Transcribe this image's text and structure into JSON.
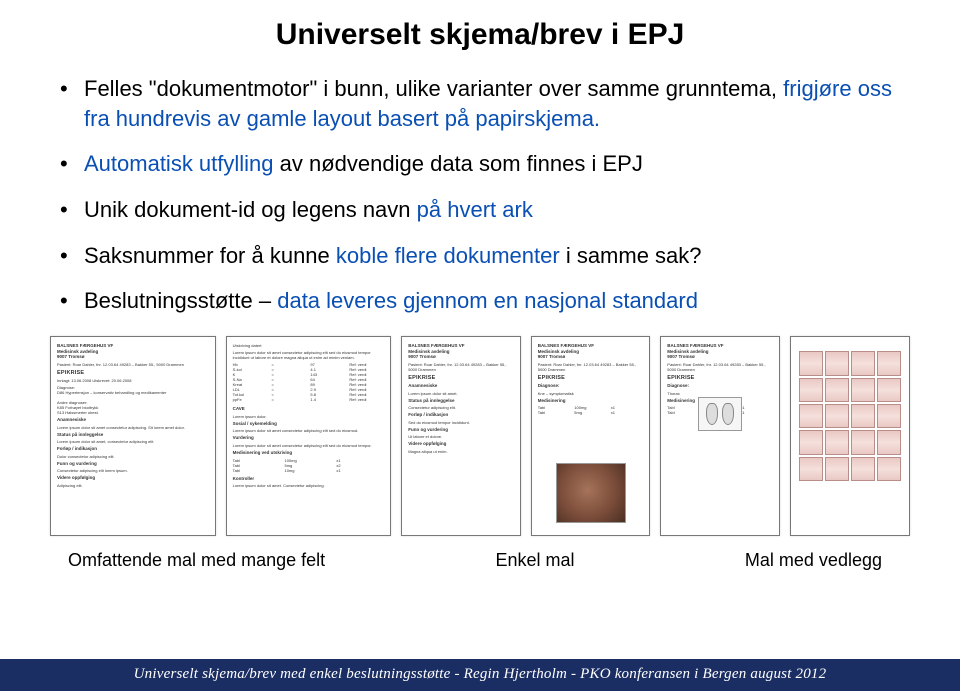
{
  "title": "Universelt skjema/brev i EPJ",
  "bullets": [
    {
      "pre": "Felles \"dokumentmotor\" i bunn, ulike varianter over samme grunntema, ",
      "blue": "frigjøre oss fra hundrevis av gamle layout basert på papirskjema.",
      "post": ""
    },
    {
      "pre": "",
      "blue": "Automatisk utfylling",
      "post": " av nødvendige data som finnes i EPJ"
    },
    {
      "pre": "Unik dokument-id og legens navn ",
      "blue": "på hvert ark",
      "post": ""
    },
    {
      "pre": "Saksnummer for å kunne ",
      "blue": "koble flere dokumenter",
      "post": " i samme sak?"
    },
    {
      "pre": "Beslutningsstøtte – ",
      "blue": "data leveres gjennom en nasjonal standard",
      "post": ""
    }
  ],
  "thumbs": {
    "t1": {
      "hdr": "BALSNES FÆRGEHUS VF\nMedisinsk avdeling\n9007 Tromsø",
      "pt": "Pasient: Roar Dahler, fnr. 12.03.64 49283 – Bakker 55., 5000 Drammen",
      "sec": "EPIKRISE",
      "p1": "Innlagt: 13.06.2008 Utskrevet: 20.06.2008",
      "p2": "Diagnose:\nD86 Hypertensjon – konservativ behandling og medikamenter\n\nAndre diagnoser:\nK85 Forhøyet blodtrykk\nS13 Halssmerter ubest.",
      "b1": "Anamnesiske",
      "b2": "Status på innleggelse",
      "b3": "Forløp / indikasjon",
      "b4": "Funn og vurdering",
      "b5": "Videre oppfølging"
    },
    "t2": {
      "top": "Utskriving datert",
      "rows": "Hb\nS-kol\nK\nS-Na\nKreat\nLDL\nTot.kol\nppFe",
      "b1": "CAVE",
      "b2": "Sosial / sykemelding",
      "b3": "Vurdering",
      "b4": "Medisinering ved utskriving",
      "b5": "Kontroller"
    },
    "t3": {
      "hdr": "BALSNES FÆRGEHUS VF\nMedisinsk avdeling\n9007 Tromsø",
      "pt": "Pasient: Roar Dahler, fnr. 12.03.64 49283 – Bakker 55., 5000 Drammen",
      "sec": "EPIKRISE",
      "b1": "Anamnesiske",
      "b2": "Status på innleggelse",
      "b3": "Forløp / indikasjon",
      "b4": "Funn og vurdering",
      "b5": "Videre oppfølging"
    },
    "t4_sec": "EPIKRISE",
    "t4_b": "Medisinering",
    "t5_sec": "EPIKRISE",
    "t5_b": "Medisinering",
    "t6_alt": "spine"
  },
  "captions": {
    "c1": "Omfattende mal med mange felt",
    "c2": "Enkel mal",
    "c3": "Mal med vedlegg"
  },
  "footer": {
    "left": "Universelt skjema/brev med enkel beslutningsstøtte",
    "mid": "Regin Hjertholm",
    "right": "PKO konferansen i Bergen august 2012",
    "sep": "   -   "
  }
}
